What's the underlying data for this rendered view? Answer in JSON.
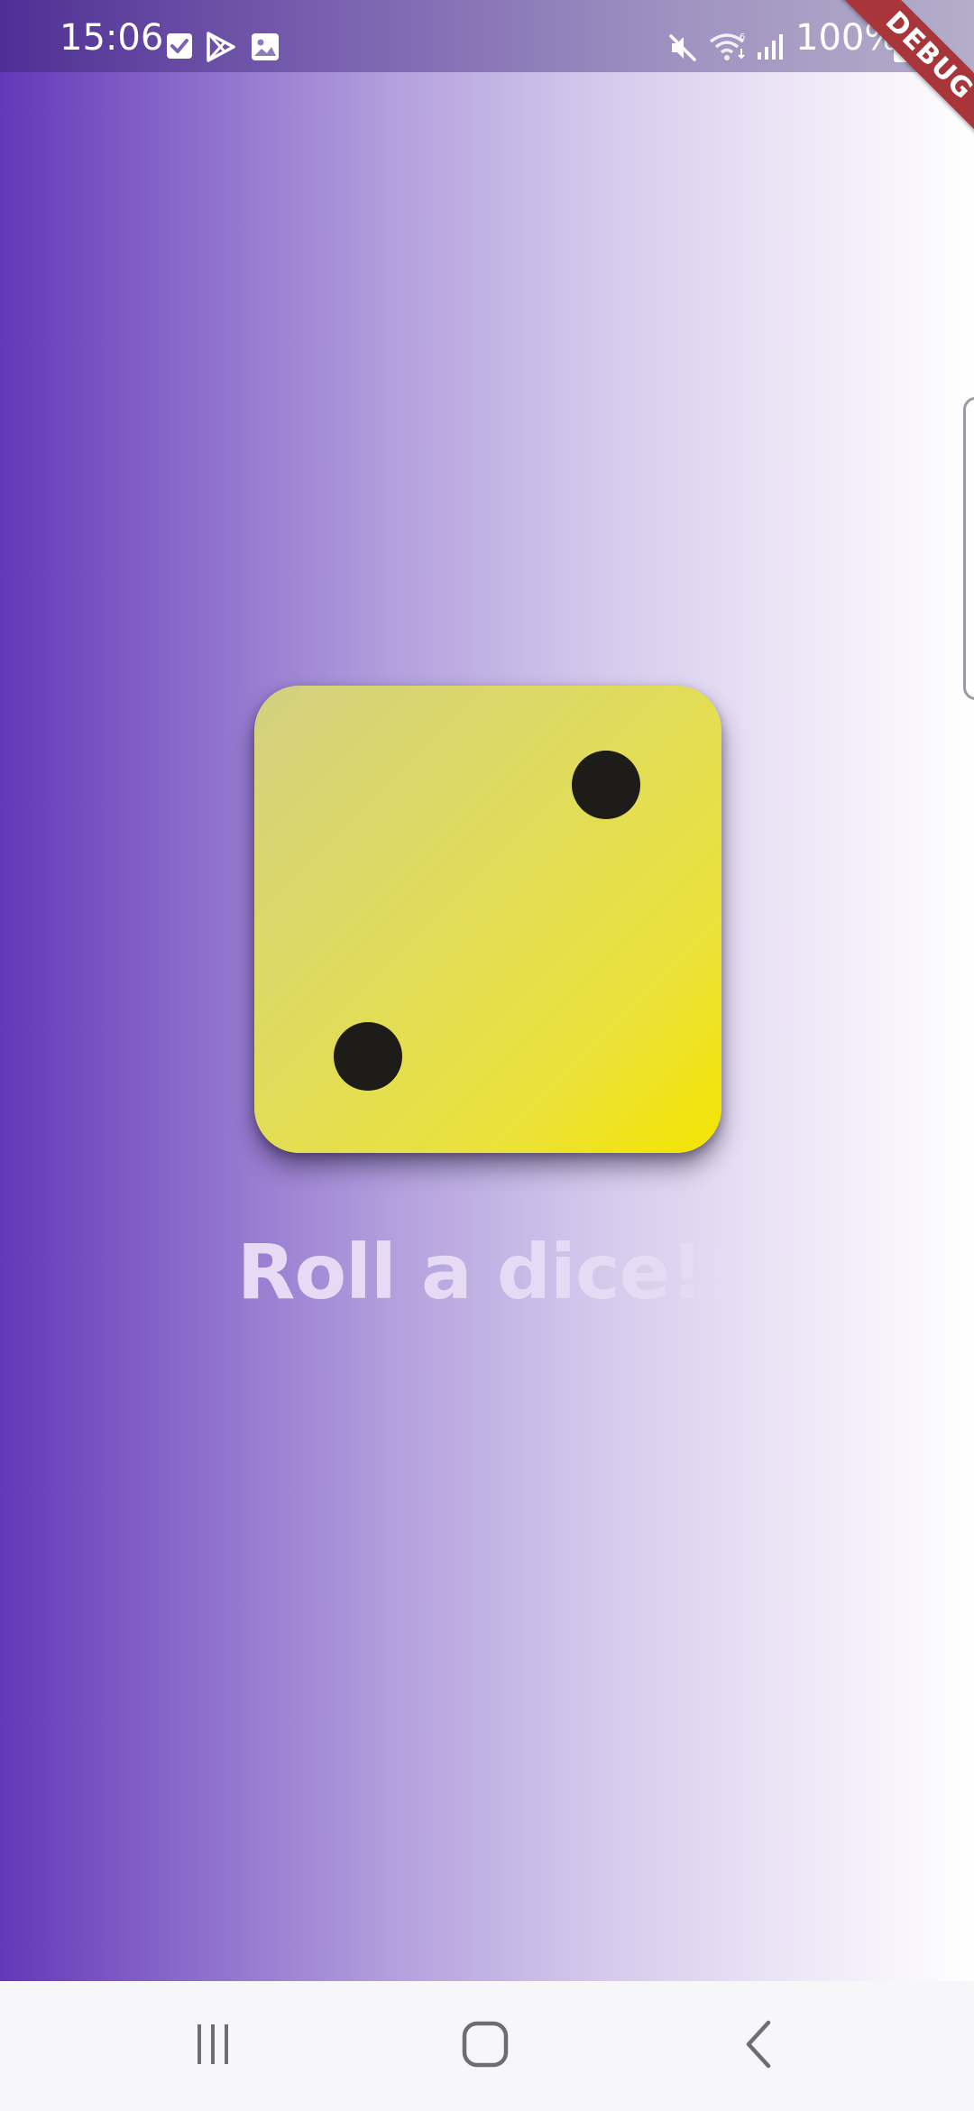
{
  "status_bar": {
    "time": "15:06",
    "battery_percent": "100%",
    "left_icons": [
      "checkbox-notification-icon",
      "play-store-icon",
      "image-icon"
    ],
    "right_icons": [
      "mute-icon",
      "wifi-icon",
      "signal-icon",
      "battery-icon"
    ]
  },
  "debug_banner": {
    "label": "DEBUG"
  },
  "dice": {
    "face_value": 2,
    "color_light": "#d3d081",
    "color_dark": "#f4e400",
    "pip_color": "#1e1c18"
  },
  "roll_button": {
    "label": "Roll a dice!!"
  },
  "nav_bar": {
    "items": [
      "recents-icon",
      "home-icon",
      "back-icon"
    ]
  },
  "colors": {
    "gradient_start": "#6437b8",
    "gradient_end": "#ffffff",
    "debug_ribbon": "#a7353a"
  }
}
